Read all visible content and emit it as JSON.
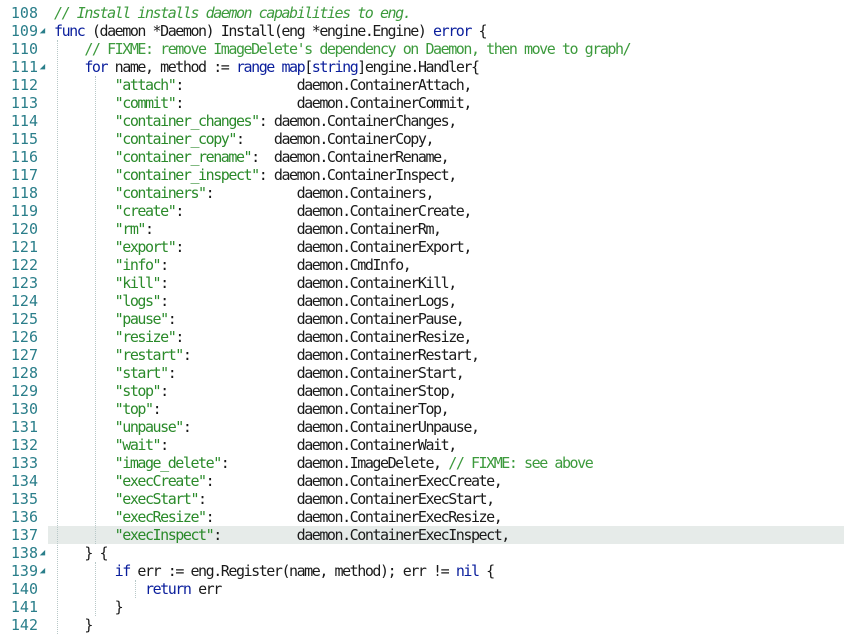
{
  "editor": {
    "lines": [
      {
        "num": "108",
        "fold": "",
        "hl": false,
        "tokens": [
          {
            "t": "// Install installs daemon capabilities to eng.",
            "c": "cmt"
          }
        ]
      },
      {
        "num": "109",
        "fold": "◢",
        "hl": false,
        "tokens": [
          {
            "t": "func",
            "c": "kw"
          },
          {
            "t": " (daemon *Daemon) Install(eng *engine.Engine) ",
            "c": ""
          },
          {
            "t": "error",
            "c": "kw"
          },
          {
            "t": " {",
            "c": ""
          }
        ]
      },
      {
        "num": "110",
        "fold": "",
        "hl": false,
        "tokens": [
          {
            "t": "    ",
            "c": ""
          },
          {
            "t": "// FIXME: remove ImageDelete's dependency on Daemon, then move to graph/",
            "c": "cmt2"
          }
        ]
      },
      {
        "num": "111",
        "fold": "◢",
        "hl": false,
        "tokens": [
          {
            "t": "    ",
            "c": ""
          },
          {
            "t": "for",
            "c": "kw"
          },
          {
            "t": " name, method := ",
            "c": ""
          },
          {
            "t": "range",
            "c": "kw"
          },
          {
            "t": " ",
            "c": ""
          },
          {
            "t": "map",
            "c": "kw"
          },
          {
            "t": "[",
            "c": ""
          },
          {
            "t": "string",
            "c": "kw"
          },
          {
            "t": "]engine.Handler{",
            "c": ""
          }
        ]
      },
      {
        "num": "112",
        "fold": "",
        "hl": false,
        "tokens": [
          {
            "t": "        ",
            "c": ""
          },
          {
            "t": "\"attach\"",
            "c": "str"
          },
          {
            "t": ":               daemon.ContainerAttach,",
            "c": ""
          }
        ]
      },
      {
        "num": "113",
        "fold": "",
        "hl": false,
        "tokens": [
          {
            "t": "        ",
            "c": ""
          },
          {
            "t": "\"commit\"",
            "c": "str"
          },
          {
            "t": ":               daemon.ContainerCommit,",
            "c": ""
          }
        ]
      },
      {
        "num": "114",
        "fold": "",
        "hl": false,
        "tokens": [
          {
            "t": "        ",
            "c": ""
          },
          {
            "t": "\"container_changes\"",
            "c": "str"
          },
          {
            "t": ": daemon.ContainerChanges,",
            "c": ""
          }
        ]
      },
      {
        "num": "115",
        "fold": "",
        "hl": false,
        "tokens": [
          {
            "t": "        ",
            "c": ""
          },
          {
            "t": "\"container_copy\"",
            "c": "str"
          },
          {
            "t": ":    daemon.ContainerCopy,",
            "c": ""
          }
        ]
      },
      {
        "num": "116",
        "fold": "",
        "hl": false,
        "tokens": [
          {
            "t": "        ",
            "c": ""
          },
          {
            "t": "\"container_rename\"",
            "c": "str"
          },
          {
            "t": ":  daemon.ContainerRename,",
            "c": ""
          }
        ]
      },
      {
        "num": "117",
        "fold": "",
        "hl": false,
        "tokens": [
          {
            "t": "        ",
            "c": ""
          },
          {
            "t": "\"container_inspect\"",
            "c": "str"
          },
          {
            "t": ": daemon.ContainerInspect,",
            "c": ""
          }
        ]
      },
      {
        "num": "118",
        "fold": "",
        "hl": false,
        "tokens": [
          {
            "t": "        ",
            "c": ""
          },
          {
            "t": "\"containers\"",
            "c": "str"
          },
          {
            "t": ":           daemon.Containers,",
            "c": ""
          }
        ]
      },
      {
        "num": "119",
        "fold": "",
        "hl": false,
        "tokens": [
          {
            "t": "        ",
            "c": ""
          },
          {
            "t": "\"create\"",
            "c": "str"
          },
          {
            "t": ":               daemon.ContainerCreate,",
            "c": ""
          }
        ]
      },
      {
        "num": "120",
        "fold": "",
        "hl": false,
        "tokens": [
          {
            "t": "        ",
            "c": ""
          },
          {
            "t": "\"rm\"",
            "c": "str"
          },
          {
            "t": ":                   daemon.ContainerRm,",
            "c": ""
          }
        ]
      },
      {
        "num": "121",
        "fold": "",
        "hl": false,
        "tokens": [
          {
            "t": "        ",
            "c": ""
          },
          {
            "t": "\"export\"",
            "c": "str"
          },
          {
            "t": ":               daemon.ContainerExport,",
            "c": ""
          }
        ]
      },
      {
        "num": "122",
        "fold": "",
        "hl": false,
        "tokens": [
          {
            "t": "        ",
            "c": ""
          },
          {
            "t": "\"info\"",
            "c": "str"
          },
          {
            "t": ":                 daemon.CmdInfo,",
            "c": ""
          }
        ]
      },
      {
        "num": "123",
        "fold": "",
        "hl": false,
        "tokens": [
          {
            "t": "        ",
            "c": ""
          },
          {
            "t": "\"kill\"",
            "c": "str"
          },
          {
            "t": ":                 daemon.ContainerKill,",
            "c": ""
          }
        ]
      },
      {
        "num": "124",
        "fold": "",
        "hl": false,
        "tokens": [
          {
            "t": "        ",
            "c": ""
          },
          {
            "t": "\"logs\"",
            "c": "str"
          },
          {
            "t": ":                 daemon.ContainerLogs,",
            "c": ""
          }
        ]
      },
      {
        "num": "125",
        "fold": "",
        "hl": false,
        "tokens": [
          {
            "t": "        ",
            "c": ""
          },
          {
            "t": "\"pause\"",
            "c": "str"
          },
          {
            "t": ":                daemon.ContainerPause,",
            "c": ""
          }
        ]
      },
      {
        "num": "126",
        "fold": "",
        "hl": false,
        "tokens": [
          {
            "t": "        ",
            "c": ""
          },
          {
            "t": "\"resize\"",
            "c": "str"
          },
          {
            "t": ":               daemon.ContainerResize,",
            "c": ""
          }
        ]
      },
      {
        "num": "127",
        "fold": "",
        "hl": false,
        "tokens": [
          {
            "t": "        ",
            "c": ""
          },
          {
            "t": "\"restart\"",
            "c": "str"
          },
          {
            "t": ":              daemon.ContainerRestart,",
            "c": ""
          }
        ]
      },
      {
        "num": "128",
        "fold": "",
        "hl": false,
        "tokens": [
          {
            "t": "        ",
            "c": ""
          },
          {
            "t": "\"start\"",
            "c": "str"
          },
          {
            "t": ":                daemon.ContainerStart,",
            "c": ""
          }
        ]
      },
      {
        "num": "129",
        "fold": "",
        "hl": false,
        "tokens": [
          {
            "t": "        ",
            "c": ""
          },
          {
            "t": "\"stop\"",
            "c": "str"
          },
          {
            "t": ":                 daemon.ContainerStop,",
            "c": ""
          }
        ]
      },
      {
        "num": "130",
        "fold": "",
        "hl": false,
        "tokens": [
          {
            "t": "        ",
            "c": ""
          },
          {
            "t": "\"top\"",
            "c": "str"
          },
          {
            "t": ":                  daemon.ContainerTop,",
            "c": ""
          }
        ]
      },
      {
        "num": "131",
        "fold": "",
        "hl": false,
        "tokens": [
          {
            "t": "        ",
            "c": ""
          },
          {
            "t": "\"unpause\"",
            "c": "str"
          },
          {
            "t": ":              daemon.ContainerUnpause,",
            "c": ""
          }
        ]
      },
      {
        "num": "132",
        "fold": "",
        "hl": false,
        "tokens": [
          {
            "t": "        ",
            "c": ""
          },
          {
            "t": "\"wait\"",
            "c": "str"
          },
          {
            "t": ":                 daemon.ContainerWait,",
            "c": ""
          }
        ]
      },
      {
        "num": "133",
        "fold": "",
        "hl": false,
        "tokens": [
          {
            "t": "        ",
            "c": ""
          },
          {
            "t": "\"image_delete\"",
            "c": "str"
          },
          {
            "t": ":         daemon.ImageDelete, ",
            "c": ""
          },
          {
            "t": "// FIXME: see above",
            "c": "cmt2"
          }
        ]
      },
      {
        "num": "134",
        "fold": "",
        "hl": false,
        "tokens": [
          {
            "t": "        ",
            "c": ""
          },
          {
            "t": "\"execCreate\"",
            "c": "str"
          },
          {
            "t": ":           daemon.ContainerExecCreate,",
            "c": ""
          }
        ]
      },
      {
        "num": "135",
        "fold": "",
        "hl": false,
        "tokens": [
          {
            "t": "        ",
            "c": ""
          },
          {
            "t": "\"execStart\"",
            "c": "str"
          },
          {
            "t": ":            daemon.ContainerExecStart,",
            "c": ""
          }
        ]
      },
      {
        "num": "136",
        "fold": "",
        "hl": false,
        "tokens": [
          {
            "t": "        ",
            "c": ""
          },
          {
            "t": "\"execResize\"",
            "c": "str"
          },
          {
            "t": ":           daemon.ContainerExecResize,",
            "c": ""
          }
        ]
      },
      {
        "num": "137",
        "fold": "",
        "hl": true,
        "tokens": [
          {
            "t": "        ",
            "c": ""
          },
          {
            "t": "\"execInspect\"",
            "c": "str"
          },
          {
            "t": ":          daemon.ContainerExecInspect,",
            "c": ""
          }
        ]
      },
      {
        "num": "138",
        "fold": "◢",
        "hl": false,
        "tokens": [
          {
            "t": "    } {",
            "c": ""
          }
        ]
      },
      {
        "num": "139",
        "fold": "◢",
        "hl": false,
        "tokens": [
          {
            "t": "        ",
            "c": ""
          },
          {
            "t": "if",
            "c": "kw"
          },
          {
            "t": " err := eng.Register(name, method); err != ",
            "c": ""
          },
          {
            "t": "nil",
            "c": "kw"
          },
          {
            "t": " {",
            "c": ""
          }
        ]
      },
      {
        "num": "140",
        "fold": "",
        "hl": false,
        "tokens": [
          {
            "t": "            ",
            "c": ""
          },
          {
            "t": "return",
            "c": "kw"
          },
          {
            "t": " err",
            "c": ""
          }
        ]
      },
      {
        "num": "141",
        "fold": "",
        "hl": false,
        "tokens": [
          {
            "t": "        }",
            "c": ""
          }
        ]
      },
      {
        "num": "142",
        "fold": "",
        "hl": false,
        "tokens": [
          {
            "t": "    }",
            "c": ""
          }
        ]
      }
    ]
  },
  "colors": {
    "keyword": "#0a1e9c",
    "string": "#2a8a2a",
    "comment": "#3c9a3c",
    "line_number": "#2a7e8a",
    "current_line": "#e6ebe9"
  }
}
